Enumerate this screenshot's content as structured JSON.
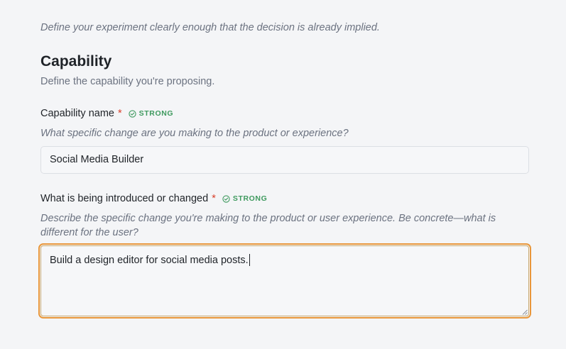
{
  "intro_text": "Define your experiment clearly enough that the decision is already implied.",
  "section": {
    "title": "Capability",
    "description": "Define the capability you're proposing."
  },
  "fields": {
    "capability_name": {
      "label": "Capability name",
      "required_mark": "*",
      "badge": "STRONG",
      "hint": "What specific change are you making to the product or experience?",
      "value": "Social Media Builder"
    },
    "introduced_changed": {
      "label": "What is being introduced or changed",
      "required_mark": "*",
      "badge": "STRONG",
      "hint": "Describe the specific change you're making to the product or user experience. Be concrete—what is different for the user?",
      "value": "Build a design editor for social media posts."
    }
  },
  "colors": {
    "badge": "#3f9a5f",
    "required": "#d9402b",
    "focus_ring": "#e8963a"
  },
  "icons": {
    "badge_icon": "check-circle-icon",
    "resize_icon": "resize-handle-icon"
  }
}
